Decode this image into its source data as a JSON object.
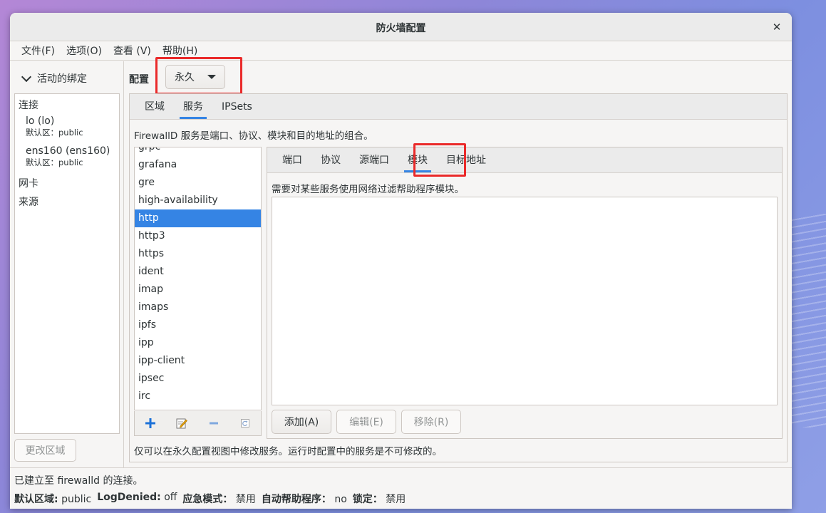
{
  "window": {
    "title": "防火墙配置",
    "close": "✕"
  },
  "menu": [
    "文件(F)",
    "选项(O)",
    "查看 (V)",
    "帮助(H)"
  ],
  "sidebar": {
    "header": "活动的绑定",
    "groups": {
      "connections": "连接",
      "interfaces": "网卡",
      "sources": "来源"
    },
    "connections": [
      {
        "name": "lo (lo)",
        "zone": "默认区：public"
      },
      {
        "name": "ens160 (ens160)",
        "zone": "默认区：public"
      }
    ],
    "change_zone_button": "更改区域"
  },
  "config": {
    "label": "配置",
    "selected": "永久"
  },
  "tabs": [
    "区域",
    "服务",
    "IPSets"
  ],
  "services": {
    "description": "FirewallD 服务是端口、协议、模块和目的地址的组合。",
    "partial_top": "grpc",
    "items": [
      "grafana",
      "gre",
      "high-availability",
      "http",
      "http3",
      "https",
      "ident",
      "imap",
      "imaps",
      "ipfs",
      "ipp",
      "ipp-client",
      "ipsec",
      "irc"
    ],
    "selected": "http",
    "tools": {
      "add": "add-icon",
      "edit": "edit-icon",
      "remove": "remove-icon",
      "reload": "reload-icon"
    }
  },
  "subtabs": [
    "端口",
    "协议",
    "源端口",
    "模块",
    "目标地址"
  ],
  "modules": {
    "description": "需要对某些服务使用网络过滤帮助程序模块。",
    "add_button": "添加(A)",
    "edit_button": "编辑(E)",
    "remove_button": "移除(R)"
  },
  "footer_note": "仅可以在永久配置视图中修改服务。运行时配置中的服务是不可修改的。",
  "status": {
    "connection": "已建立至 firewalld 的连接。",
    "default_zone_label": "默认区域:",
    "default_zone": "public",
    "logdenied_label": "LogDenied:",
    "logdenied": "off",
    "panic_label": "应急模式：",
    "panic": "禁用",
    "helpers_label": "自动帮助程序：",
    "helpers": "no",
    "lockdown_label": "锁定：",
    "lockdown": "禁用"
  },
  "colors": {
    "accent": "#3584e4",
    "highlight_box": "#ea2a2a"
  }
}
